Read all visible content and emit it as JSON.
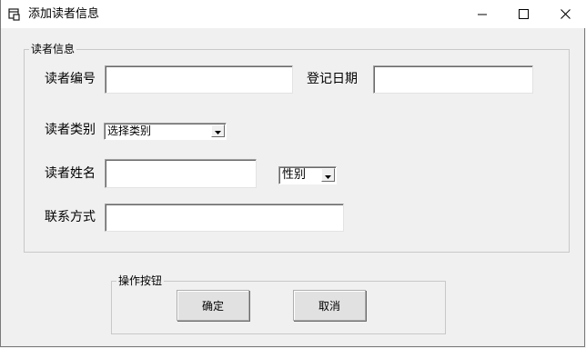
{
  "window": {
    "title": "添加读者信息",
    "icons": {
      "app": "form-app-icon",
      "minimize": "minimize-icon",
      "maximize": "maximize-icon",
      "close": "close-icon"
    }
  },
  "reader_group": {
    "legend": "读者信息",
    "fields": {
      "reader_id_label": "读者编号",
      "reader_id_value": "",
      "register_date_label": "登记日期",
      "register_date_value": "",
      "category_label": "读者类别",
      "category_selected": "选择类别",
      "name_label": "读者姓名",
      "name_value": "",
      "gender_selected": "性别",
      "contact_label": "联系方式",
      "contact_value": ""
    }
  },
  "actions_group": {
    "legend": "操作按钮",
    "confirm_label": "确定",
    "cancel_label": "取消"
  }
}
